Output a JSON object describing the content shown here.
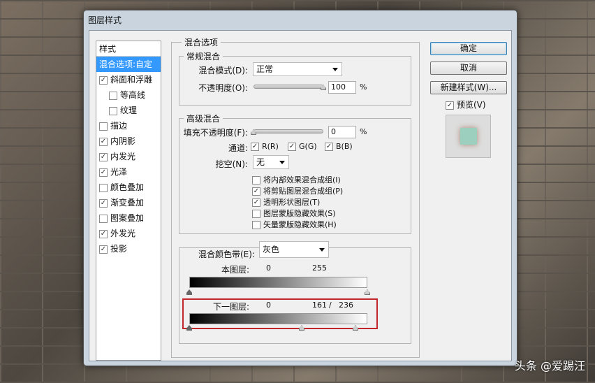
{
  "dialog": {
    "title": "图层样式"
  },
  "sidebar": {
    "header": "样式",
    "items": [
      {
        "label": "混合选项:自定",
        "selected": true
      },
      {
        "label": "斜面和浮雕",
        "checked": true
      },
      {
        "label": "等高线",
        "checked": false,
        "sub": true
      },
      {
        "label": "纹理",
        "checked": false,
        "sub": true
      },
      {
        "label": "描边",
        "checked": false
      },
      {
        "label": "内阴影",
        "checked": true
      },
      {
        "label": "内发光",
        "checked": true
      },
      {
        "label": "光泽",
        "checked": true
      },
      {
        "label": "颜色叠加",
        "checked": false
      },
      {
        "label": "渐变叠加",
        "checked": true
      },
      {
        "label": "图案叠加",
        "checked": false
      },
      {
        "label": "外发光",
        "checked": true
      },
      {
        "label": "投影",
        "checked": true
      }
    ]
  },
  "blend": {
    "title": "混合选项",
    "general": {
      "title": "常规混合",
      "mode_label": "混合模式(D):",
      "mode": "正常",
      "opacity_label": "不透明度(O):",
      "opacity": "100",
      "opacity_fraction": 1.0,
      "pct": "%"
    },
    "advanced": {
      "title": "高级混合",
      "fill_label": "填充不透明度(F):",
      "fill": "0",
      "fill_fraction": 0,
      "pct": "%",
      "channels_label": "通道:",
      "r": "R(R)",
      "g": "G(G)",
      "b": "B(B)",
      "knockout_label": "挖空(N):",
      "knockout": "无",
      "options": [
        {
          "label": "将内部效果混合成组(I)",
          "checked": false
        },
        {
          "label": "将剪贴图层混合成组(P)",
          "checked": true
        },
        {
          "label": "透明形状图层(T)",
          "checked": true
        },
        {
          "label": "图层蒙版隐藏效果(S)",
          "checked": false
        },
        {
          "label": "矢量蒙版隐藏效果(H)",
          "checked": false
        }
      ]
    },
    "blend_if": {
      "label": "混合颜色带(E):",
      "value": "灰色",
      "this_layer": {
        "label": "本图层:",
        "low": "0",
        "high": "255"
      },
      "underlying": {
        "label": "下一图层:",
        "low": "0",
        "high_a": "161",
        "sep": "/",
        "high_b": "236"
      }
    }
  },
  "buttons": {
    "ok": "确定",
    "cancel": "取消",
    "new_style": "新建样式(W)...",
    "preview": "预览(V)"
  },
  "watermark": "头条 @爱踢汪"
}
